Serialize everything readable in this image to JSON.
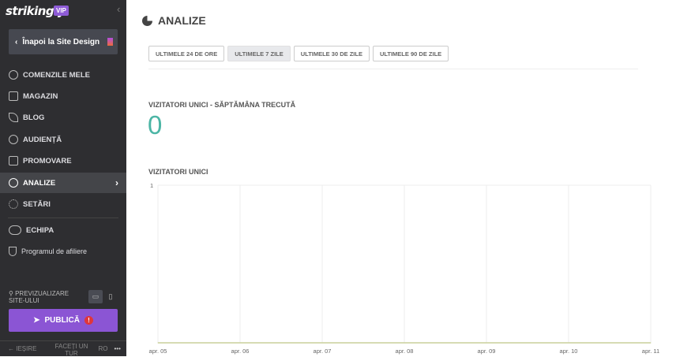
{
  "sidebar": {
    "logo": "strikingly",
    "vip": "VIP",
    "back": "Înapoi la Site Design",
    "items": [
      {
        "label": "COMENZILE MELE"
      },
      {
        "label": "MAGAZIN"
      },
      {
        "label": "BLOG"
      },
      {
        "label": "AUDIENȚĂ"
      },
      {
        "label": "PROMOVARE"
      },
      {
        "label": "ANALIZE"
      },
      {
        "label": "SETĂRI"
      },
      {
        "label": "ECHIPA"
      },
      {
        "label": "Programul de afiliere"
      }
    ],
    "preview": "PREVIZUALIZARE SITE-ULUI",
    "publish": "PUBLICĂ",
    "warn": "!",
    "exit": "IEȘIRE",
    "tour": "FACEȚI UN TUR",
    "lang": "RO",
    "more": "•••"
  },
  "main": {
    "title": "ANALIZE",
    "tabs": [
      "ULTIMELE 24 DE ORE",
      "ULTIMELE 7 ZILE",
      "ULTIMELE 30 DE ZILE",
      "ULTIMELE 90 DE ZILE"
    ],
    "unique_label": "VIZITATORI UNICI - SĂPTĂMÂNA TRECUTĂ",
    "unique_value": "0",
    "chart_label": "VIZITATORI UNICI"
  },
  "chart_data": {
    "type": "line",
    "title": "VIZITATORI UNICI",
    "categories": [
      "apr. 05",
      "apr. 06",
      "apr. 07",
      "apr. 08",
      "apr. 09",
      "apr. 10",
      "apr. 11"
    ],
    "values": [
      0,
      0,
      0,
      0,
      0,
      0,
      0
    ],
    "ylim": [
      0,
      1
    ],
    "yticks": [
      "1"
    ],
    "grid": true,
    "color": "#c8cf9a"
  }
}
